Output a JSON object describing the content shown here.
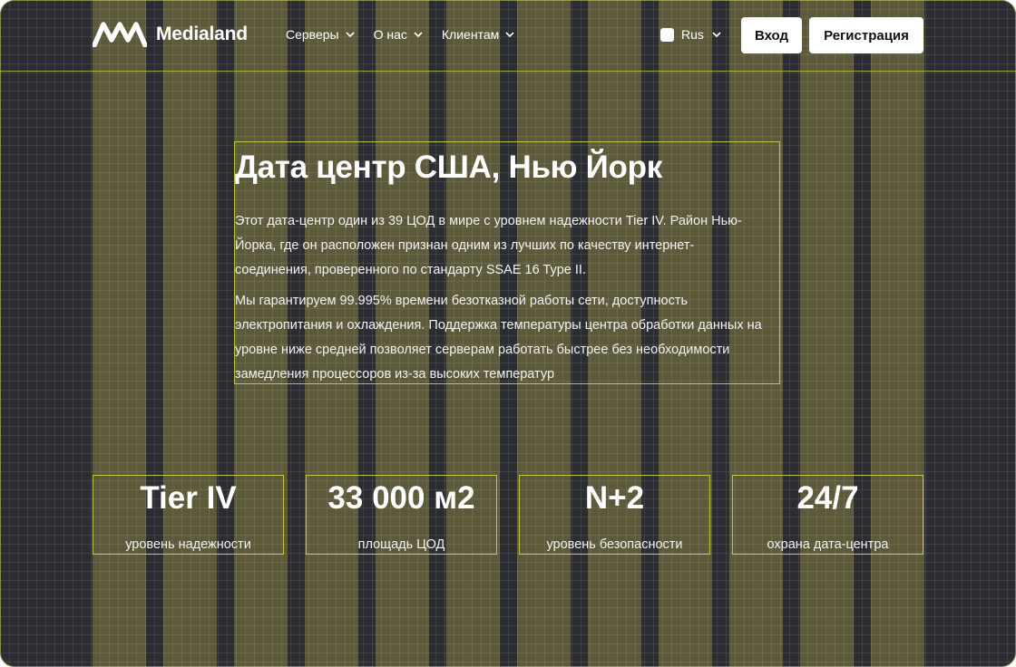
{
  "header": {
    "brand": "Medialand",
    "nav": [
      {
        "label": "Серверы",
        "icon": "chevron-down-icon"
      },
      {
        "label": "О нас",
        "icon": "chevron-down-icon"
      },
      {
        "label": "Клиентам",
        "icon": "chevron-down-icon"
      }
    ],
    "language": {
      "selected": "Rus",
      "icon": "flag-icon"
    },
    "login_label": "Вход",
    "register_label": "Регистрация"
  },
  "hero": {
    "title": "Дата центр США, Нью Йорк",
    "paragraph1": "Этот дата-центр один из 39 ЦОД в мире с уровнем надежности Tier IV. Район Нью-Йорка, где он расположен признан одним из лучших по качеству интернет-соединения, проверенного по стандарту SSAE 16 Type II.",
    "paragraph2": "Мы гарантируем 99.995% времени безотказной работы сети, доступность электропитания и охлаждения. Поддержка температуры центра обработки данных на уровне ниже средней позволяет серверам работать быстрее без необходимости замедления процессоров из-за высоких температур"
  },
  "stats": [
    {
      "value": "Tier IV",
      "label": "уровень надежности"
    },
    {
      "value": "33 000 м2",
      "label": "площадь ЦОД"
    },
    {
      "value": "N+2",
      "label": "уровень безопасности"
    },
    {
      "value": "24/7",
      "label": "охрана дата-центра"
    }
  ],
  "colors": {
    "background": "#2c2c33",
    "column_overlay": "#5c5a3a",
    "guide_lines": "#d7d746",
    "text": "#ffffff",
    "button_bg": "#ffffff"
  }
}
